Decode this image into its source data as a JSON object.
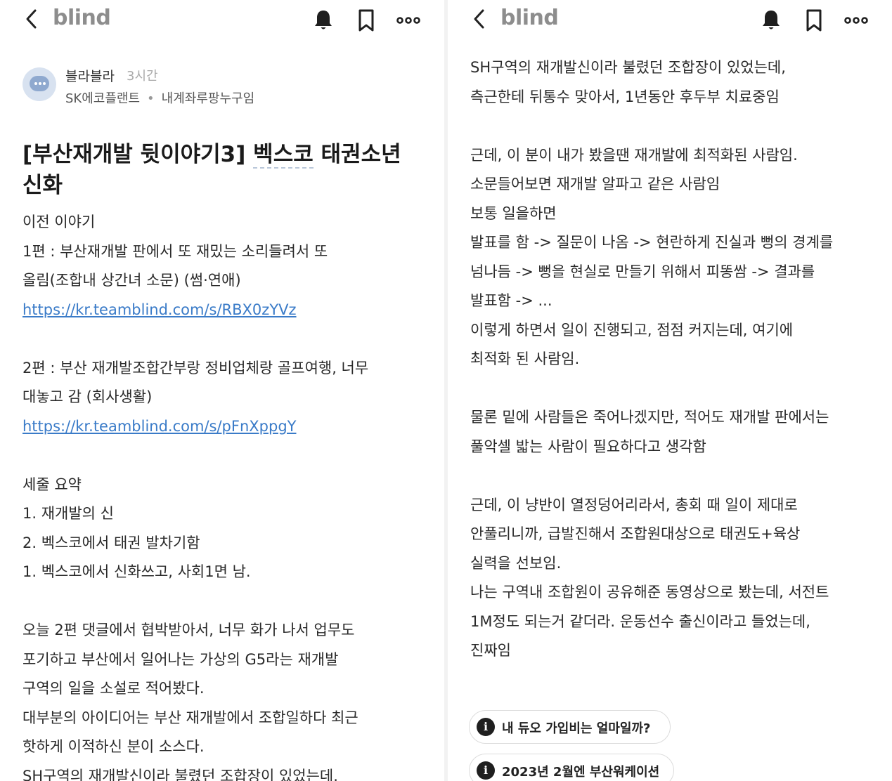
{
  "app": {
    "logo": "blind"
  },
  "left": {
    "author": {
      "name": "블라블라",
      "time": "3시간",
      "company": "SK에코플랜트",
      "separator": "•",
      "nickname": "내계좌루팡누구임"
    },
    "title_line1_a": "[부산재개발 뒷이야기3] ",
    "title_line1_b": "벡스코",
    "title_line1_c": " 태권소년",
    "title_line2": "신화",
    "lines": [
      "이전 이야기",
      "1편 : 부산재개발 판에서 또 재밌는 소리들려서 또",
      "올림(조합내 상간녀 소문) (썸·연애)",
      "https://kr.teamblind.com/s/RBX0zYVz",
      "",
      "2편 : 부산 재개발조합간부랑 정비업체랑 골프여행, 너무",
      "대놓고 감 (회사생활)",
      "https://kr.teamblind.com/s/pFnXppgY",
      "",
      "세줄 요약",
      "1. 재개발의 신",
      "2. 벡스코에서 태권 발차기함",
      "1. 벡스코에서 신화쓰고, 사회1면 남.",
      "",
      "오늘 2편 댓글에서 협박받아서, 너무 화가 나서 업무도",
      "포기하고 부산에서 일어나는 가상의 G5라는 재개발",
      "구역의 일을 소설로 적어봤다.",
      "대부분의 아이디어는 부산 재개발에서 조합일하다 최근",
      "핫하게 이적하신 분이 소스다.",
      "SH구역의 재개발신이라 불렸던 조합장이 있었는데."
    ]
  },
  "right": {
    "lines": [
      "SH구역의 재개발신이라 불렸던 조합장이 있었는데,",
      "측근한테 뒤통수 맞아서, 1년동안 후두부 치료중임",
      "",
      "근데, 이 분이 내가 봤을땐 재개발에 최적화된 사람임.",
      "소문들어보면 재개발 알파고 같은 사람임",
      "보통 일을하면",
      "발표를 함 -> 질문이 나옴 -> 현란하게 진실과 뻥의 경계를",
      "넘나듬 -> 뻥을 현실로 만들기 위해서 피똥쌈 -> 결과를",
      "발표함 -> ...",
      "이렇게 하면서 일이 진행되고, 점점 커지는데, 여기에",
      "최적화 된 사람임.",
      "",
      "물론 밑에 사람들은 죽어나겠지만, 적어도 재개발 판에서는",
      "풀악셀 밟는 사람이 필요하다고 생각함",
      "",
      "근데, 이 냥반이 열정덩어리라서, 총회 때 일이 제대로",
      "안풀리니까, 급발진해서 조합원대상으로 태권도+육상",
      "실력을 선보임.",
      "나는 구역내 조합원이 공유해준 동영상으로 봤는데, 서전트",
      "1M정도 되는거 같더라. 운동선수 출신이라고 들었는데,",
      "진짜임"
    ],
    "chips": [
      {
        "icon": "i",
        "label": "내 듀오 가입비는 얼마일까?"
      },
      {
        "icon": "i",
        "label": "2023년 2월엔 부산워케이션"
      }
    ]
  },
  "colors": {
    "link": "#3a7bc8",
    "logo": "#8d8d8d",
    "avatar": "#d8e2f0"
  }
}
